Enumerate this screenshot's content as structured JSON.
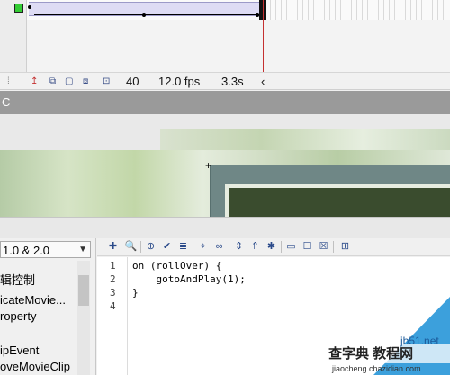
{
  "timeline": {
    "frame_count": "40",
    "fps": "12.0 fps",
    "time": "3.3s",
    "colors": {
      "tween": "#dedcf4",
      "playhead": "#c43030",
      "layer_color": "#33cc33"
    },
    "icons": [
      "onion-skin-icon",
      "onion-outline-icon",
      "edit-multiple-icon",
      "modify-markers-icon",
      "center-frame-icon"
    ]
  },
  "scene": {
    "label": "C"
  },
  "actions_panel": {
    "version": "1.0 & 2.0",
    "list_items": [
      "辑控制",
      "icateMovie...",
      "roperty",
      "ipEvent",
      "oveMovieClip"
    ],
    "toolbar_icons": [
      "add-statement-icon",
      "find-icon",
      "target-path-icon",
      "check-syntax-icon",
      "auto-format-icon",
      "code-hint-icon",
      "debug-icon",
      "collapse-braces-icon",
      "collapse-selection-icon",
      "expand-all-icon",
      "comment-block-icon",
      "comment-line-icon",
      "uncomment-icon",
      "script-assist-icon"
    ],
    "code_lines": [
      {
        "num": "1",
        "text": "on (rollOver) {"
      },
      {
        "num": "2",
        "text": "    gotoAndPlay(1);"
      },
      {
        "num": "3",
        "text": "}"
      },
      {
        "num": "4",
        "text": ""
      }
    ]
  },
  "watermark": {
    "title": "查字典 教程网",
    "site": "jb51.net",
    "url": "jiaocheng.chazidian.com"
  }
}
